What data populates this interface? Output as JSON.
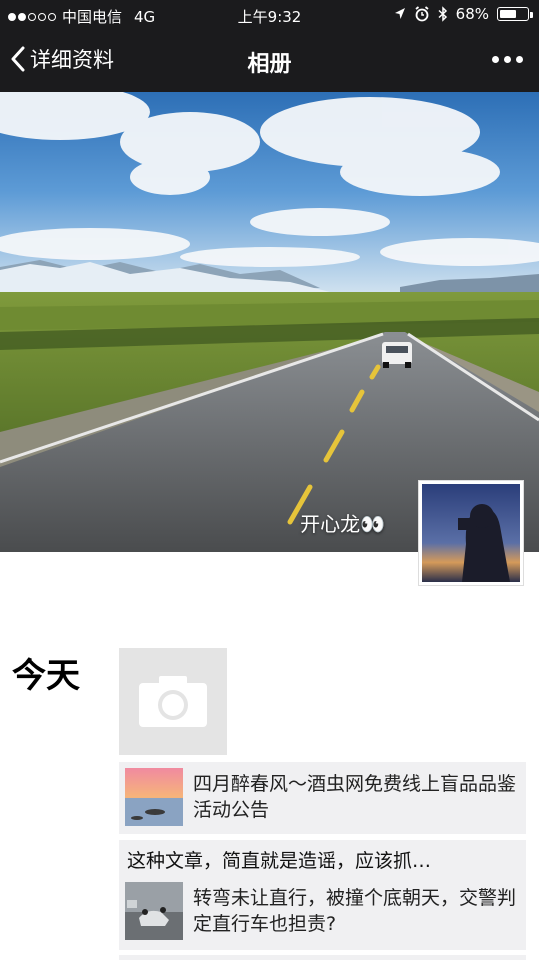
{
  "status_bar": {
    "carrier": "中国电信",
    "network": "4G",
    "time": "上午9:32",
    "battery": "68%",
    "battery_level": 0.68,
    "icons": [
      "signal-dots",
      "location-arrow-icon",
      "alarm-clock-icon",
      "bluetooth-icon",
      "battery-icon"
    ]
  },
  "nav": {
    "back_label": "详细资料",
    "title": "相册",
    "more_icon": "more-dots-icon"
  },
  "profile": {
    "nickname": "开心龙👀"
  },
  "timeline": {
    "day": "今天",
    "camera_icon": "camera-icon",
    "posts": [
      {
        "share_title": "四月醉春风～酒虫网免费线上盲品品鉴活动公告"
      },
      {
        "text": "这种文章，简直就是造谣，应该抓…",
        "share_title": "转弯未让直行，被撞个底朝天，交警判定直行车也担责?"
      }
    ]
  },
  "colors": {
    "bar_bg": "#1b1b1d",
    "post_bg": "#f0f0f2",
    "tile_bg": "#e4e4e4"
  }
}
